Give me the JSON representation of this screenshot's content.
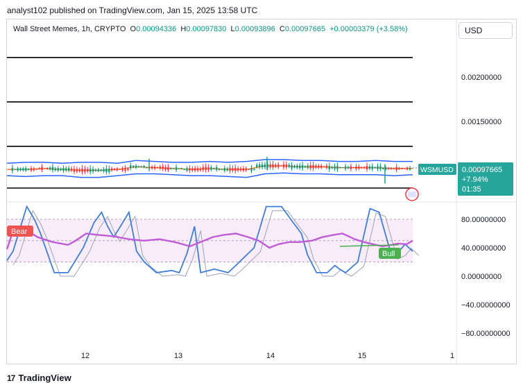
{
  "publisher_line": "analyst102 published on TradingView.com, Jan 15, 2025 13:58 UTC",
  "legend": {
    "symbol": "Wall Street Memes, 1h, CRYPTO",
    "o_label": "O",
    "o_value": "0.00094336",
    "h_label": "H",
    "h_value": "0.00097830",
    "l_label": "L",
    "l_value": "0.00093896",
    "c_label": "C",
    "c_value": "0.00097665",
    "change": "+0.00003379 (+3.58%)"
  },
  "currency_button": "USD",
  "price_tag": {
    "symbol": "WSMUSD",
    "price": "0.00097665",
    "change": "+7.94%",
    "countdown": "01:35"
  },
  "badges": {
    "bear": "Bear",
    "bull": "Bull"
  },
  "footer_brand": "TradingView",
  "colors": {
    "up": "#089981",
    "down": "#f23645",
    "bollinger": "#2962ff",
    "midband": "#ff6d00",
    "stoch_k": "#3d7dd8",
    "rsi": "#c05cd6",
    "rsi_band": "#f5e4f7",
    "bull": "#4caf50",
    "bear": "#ef5350",
    "price_tag": "#26a69a"
  },
  "chart_data": [
    {
      "type": "candlestick",
      "title": "Wall Street Memes, 1h, CRYPTO",
      "y_axis_ticks": [
        "0.00200000",
        "0.00150000"
      ],
      "ylim": [
        0.00071,
        0.0026
      ],
      "x_tick_labels": [
        "12",
        "13",
        "14",
        "15",
        "1"
      ],
      "horizontal_levels": [
        0.00222,
        0.00172,
        0.00122,
        0.00075
      ],
      "last_price": 0.00097665,
      "bollinger_upper": [
        0.00103,
        0.00104,
        0.00104,
        0.00103,
        0.00104,
        0.00104,
        0.00103,
        0.00106,
        0.00105,
        0.00104,
        0.00104,
        0.00105,
        0.00104,
        0.00105,
        0.00107,
        0.00107,
        0.00106,
        0.00106,
        0.00105,
        0.00105,
        0.00106,
        0.00105,
        0.00105
      ],
      "bollinger_mid": [
        0.00096,
        0.00096,
        0.00097,
        0.00096,
        0.00095,
        0.00095,
        0.00096,
        0.00099,
        0.00098,
        0.00097,
        0.00096,
        0.00097,
        0.00096,
        0.00096,
        0.001,
        0.001,
        0.00099,
        0.00099,
        0.00098,
        0.00098,
        0.00098,
        0.00097,
        0.00097
      ],
      "bollinger_lower": [
        0.00089,
        0.00088,
        0.00089,
        0.00089,
        0.00087,
        0.00087,
        0.00089,
        0.00091,
        0.00091,
        0.0009,
        0.00089,
        0.00089,
        0.00088,
        0.00087,
        0.00091,
        0.00092,
        0.00091,
        0.00091,
        0.0009,
        0.0009,
        0.0009,
        0.00089,
        0.0009
      ]
    },
    {
      "type": "line",
      "y_axis_ticks": [
        "80.00000000",
        "40.00000000",
        "0.00000000",
        "−40.00000000",
        "−80.00000000"
      ],
      "ylim": [
        -100,
        120
      ],
      "band": [
        20,
        80
      ],
      "midline": 50,
      "series": [
        {
          "values": [
            22,
            40,
            98,
            80,
            60,
            5,
            5,
            40,
            75,
            90,
            70,
            55,
            72,
            90,
            35,
            20,
            5,
            8,
            5,
            32,
            70,
            5,
            10,
            5,
            15,
            40,
            98,
            98,
            80,
            60,
            30,
            5,
            5,
            15,
            10,
            5,
            20,
            95,
            90,
            60,
            30,
            35,
            45,
            35
          ]
        },
        {
          "values": [
            38,
            70,
            66,
            55,
            48,
            44,
            50,
            60,
            58,
            56,
            52,
            50,
            52,
            48,
            42,
            48,
            55,
            58,
            60,
            55,
            50,
            40,
            45,
            48,
            48,
            50,
            55,
            58,
            60,
            52,
            48,
            45,
            42,
            44,
            46,
            45,
            50,
            52,
            46,
            50,
            52,
            48,
            50,
            55
          ]
        }
      ],
      "stoch_k_knots": [
        [
          0,
          22
        ],
        [
          4,
          35
        ],
        [
          13,
          98
        ],
        [
          18,
          80
        ],
        [
          22,
          60
        ],
        [
          31,
          5
        ],
        [
          40,
          5
        ],
        [
          50,
          40
        ],
        [
          57,
          75
        ],
        [
          62,
          90
        ],
        [
          66,
          70
        ],
        [
          70,
          55
        ],
        [
          75,
          72
        ],
        [
          80,
          90
        ],
        [
          85,
          35
        ],
        [
          90,
          20
        ],
        [
          98,
          5
        ],
        [
          108,
          8
        ],
        [
          113,
          5
        ],
        [
          118,
          32
        ],
        [
          123,
          70
        ],
        [
          127,
          5
        ],
        [
          136,
          10
        ],
        [
          145,
          5
        ],
        [
          150,
          15
        ],
        [
          162,
          40
        ],
        [
          170,
          98
        ],
        [
          180,
          98
        ],
        [
          186,
          80
        ],
        [
          193,
          60
        ],
        [
          197,
          30
        ],
        [
          203,
          5
        ],
        [
          210,
          5
        ],
        [
          215,
          15
        ],
        [
          218,
          10
        ],
        [
          222,
          5
        ],
        [
          230,
          20
        ],
        [
          238,
          95
        ],
        [
          244,
          90
        ],
        [
          248,
          60
        ],
        [
          252,
          30
        ],
        [
          257,
          35
        ],
        [
          261,
          45
        ],
        [
          266,
          35
        ]
      ],
      "rsi_knots": [
        [
          0,
          38
        ],
        [
          5,
          70
        ],
        [
          12,
          66
        ],
        [
          20,
          55
        ],
        [
          30,
          48
        ],
        [
          40,
          44
        ],
        [
          45,
          50
        ],
        [
          52,
          60
        ],
        [
          60,
          58
        ],
        [
          70,
          56
        ],
        [
          80,
          52
        ],
        [
          90,
          50
        ],
        [
          100,
          52
        ],
        [
          110,
          48
        ],
        [
          120,
          42
        ],
        [
          127,
          48
        ],
        [
          135,
          55
        ],
        [
          142,
          58
        ],
        [
          150,
          60
        ],
        [
          158,
          55
        ],
        [
          165,
          50
        ],
        [
          172,
          40
        ],
        [
          178,
          45
        ],
        [
          185,
          48
        ],
        [
          192,
          48
        ],
        [
          200,
          50
        ],
        [
          207,
          55
        ],
        [
          214,
          58
        ],
        [
          220,
          60
        ],
        [
          228,
          52
        ],
        [
          234,
          48
        ],
        [
          240,
          45
        ],
        [
          246,
          42
        ],
        [
          252,
          44
        ],
        [
          256,
          46
        ],
        [
          262,
          45
        ],
        [
          266,
          50
        ]
      ]
    }
  ]
}
